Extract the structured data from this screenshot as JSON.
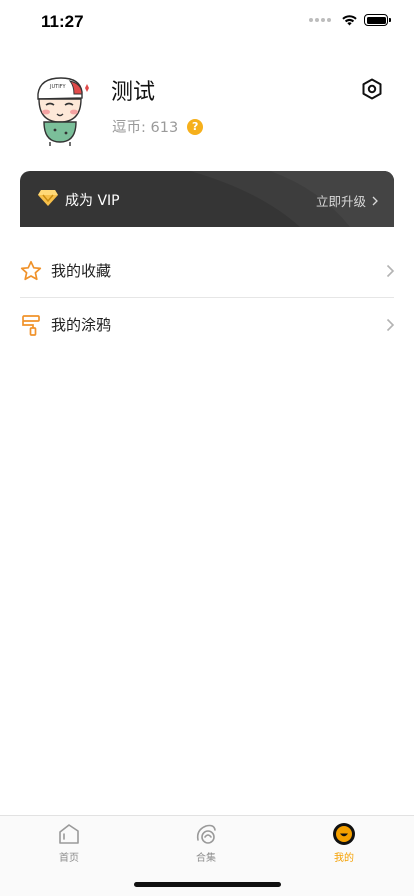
{
  "status_bar": {
    "time": "11:27"
  },
  "profile": {
    "username": "测试",
    "coins_label": "逗币: 613",
    "help_symbol": "?"
  },
  "vip": {
    "title": "成为 VIP",
    "action": "立即升级"
  },
  "menu": {
    "items": [
      {
        "label": "我的收藏",
        "icon": "star-icon"
      },
      {
        "label": "我的涂鸦",
        "icon": "paint-roller-icon"
      }
    ]
  },
  "tabs": [
    {
      "label": "首页",
      "icon": "home-icon",
      "active": false
    },
    {
      "label": "合集",
      "icon": "collection-icon",
      "active": false
    },
    {
      "label": "我的",
      "icon": "profile-smiley-icon",
      "active": true
    }
  ],
  "colors": {
    "accent": "#f5a000",
    "vip_background": "#353535",
    "icon_orange": "#f0922a"
  }
}
